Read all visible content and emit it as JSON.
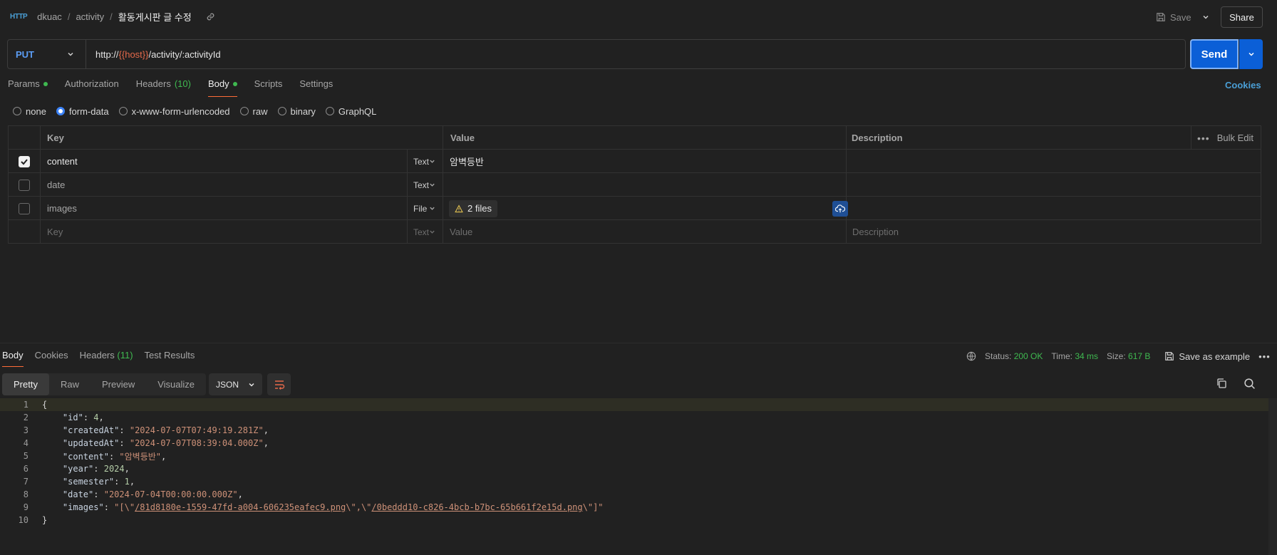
{
  "header": {
    "breadcrumb": [
      "dkuac",
      "activity",
      "활동게시판 글 수정"
    ],
    "save_label": "Save",
    "share_label": "Share"
  },
  "request": {
    "method": "PUT",
    "url_prefix": "http://",
    "url_var": "{{host}}",
    "url_suffix": "/activity/:activityId",
    "send_label": "Send"
  },
  "tabs": {
    "params": "Params",
    "authorization": "Authorization",
    "headers": "Headers",
    "headers_count": "(10)",
    "body": "Body",
    "scripts": "Scripts",
    "settings": "Settings",
    "cookies": "Cookies"
  },
  "body_types": [
    "none",
    "form-data",
    "x-www-form-urlencoded",
    "raw",
    "binary",
    "GraphQL"
  ],
  "form_table": {
    "headers": {
      "key": "Key",
      "value": "Value",
      "description": "Description",
      "bulk_edit": "Bulk Edit"
    },
    "rows": [
      {
        "key": "content",
        "type": "Text",
        "value": "암벽등반",
        "checked": true
      },
      {
        "key": "date",
        "type": "Text",
        "value": "",
        "checked": false
      },
      {
        "key": "images",
        "type": "File",
        "value": "2 files",
        "checked": false
      }
    ],
    "placeholder": {
      "key": "Key",
      "type": "Text",
      "value": "Value",
      "description": "Description"
    }
  },
  "response": {
    "tabs": [
      "Body",
      "Cookies",
      "Headers",
      "Test Results"
    ],
    "headers_count": "(11)",
    "status_label": "Status:",
    "status_value": "200 OK",
    "time_label": "Time:",
    "time_value": "34 ms",
    "size_label": "Size:",
    "size_value": "617 B",
    "save_example": "Save as example",
    "view_tabs": [
      "Pretty",
      "Raw",
      "Preview",
      "Visualize"
    ],
    "format": "JSON"
  },
  "code_lines": [
    "1",
    "2",
    "3",
    "4",
    "5",
    "6",
    "7",
    "8",
    "9",
    "10"
  ],
  "json_body": {
    "id": "4",
    "createdAt": "\"2024-07-07T07:49:19.281Z\"",
    "updatedAt": "\"2024-07-07T08:39:04.000Z\"",
    "content": "\"암벽등반\"",
    "year": "2024",
    "semester": "1",
    "date": "\"2024-07-04T00:00:00.000Z\"",
    "images_pre": "\"[\\\"",
    "images_link1": "/81d8180e-1559-47fd-a004-606235eafec9.png",
    "images_mid": "\\\",\\\"",
    "images_link2": "/0beddd10-c826-4bcb-b7bc-65b661f2e15d.png",
    "images_post": "\\\"]\""
  },
  "colors": {
    "accent": "#ff6c37",
    "send": "#0b5fd7",
    "ok": "#3fb950",
    "link": "#4a9fd6"
  }
}
